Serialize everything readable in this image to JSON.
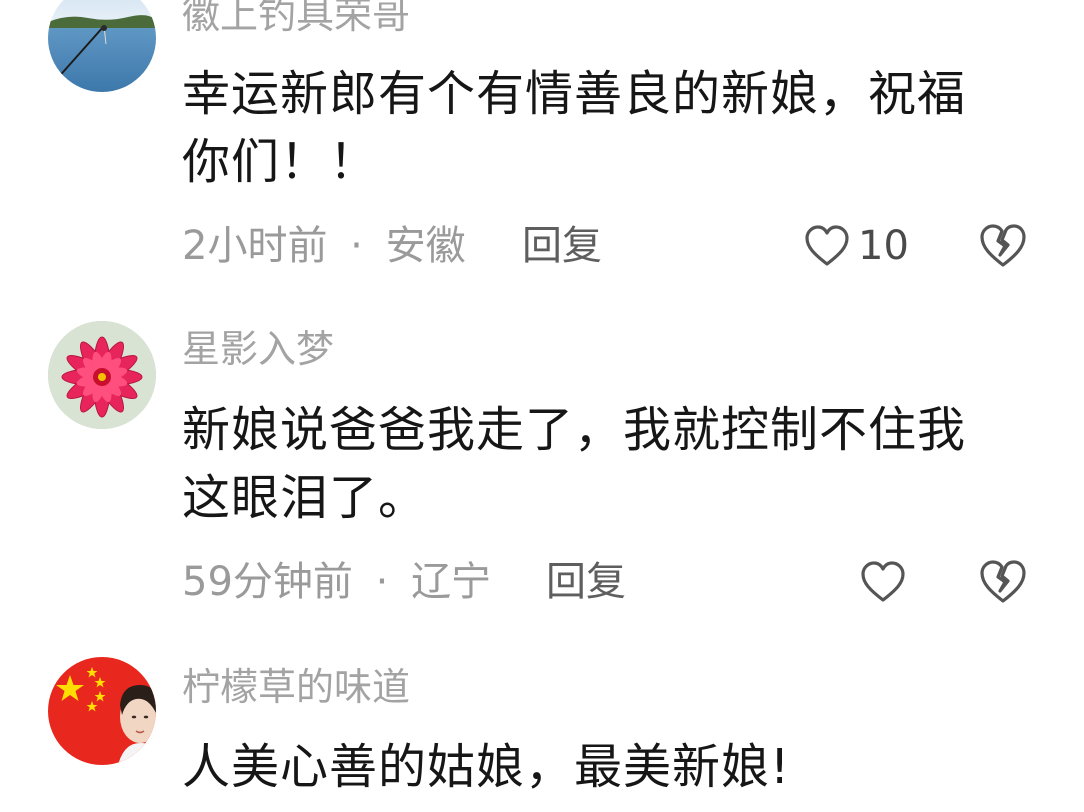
{
  "comments": [
    {
      "username": "徽上钓具荣哥",
      "text": "幸运新郎有个有情善良的新娘，祝福你们！！",
      "time": "2小时前",
      "separator": "·",
      "location": "安徽",
      "reply_label": "回复",
      "likes": "10",
      "avatar_icon": "lake-fishing-rod-avatar"
    },
    {
      "username": "星影入梦",
      "text": "新娘说爸爸我走了，我就控制不住我这眼泪了。",
      "time": "59分钟前",
      "separator": "·",
      "location": "辽宁",
      "reply_label": "回复",
      "likes": "",
      "avatar_icon": "red-flower-avatar"
    },
    {
      "username": "柠檬草的味道",
      "text": "人美心善的姑娘，最美新娘!",
      "avatar_icon": "china-flag-portrait-avatar"
    }
  ],
  "icons": {
    "like": "heart-outline-icon",
    "dislike": "broken-heart-icon"
  },
  "colors": {
    "username": "#a3a3a3",
    "text": "#161616",
    "meta": "#9a9a9a",
    "flag_red": "#e8281e",
    "flag_star": "#ffde00"
  }
}
